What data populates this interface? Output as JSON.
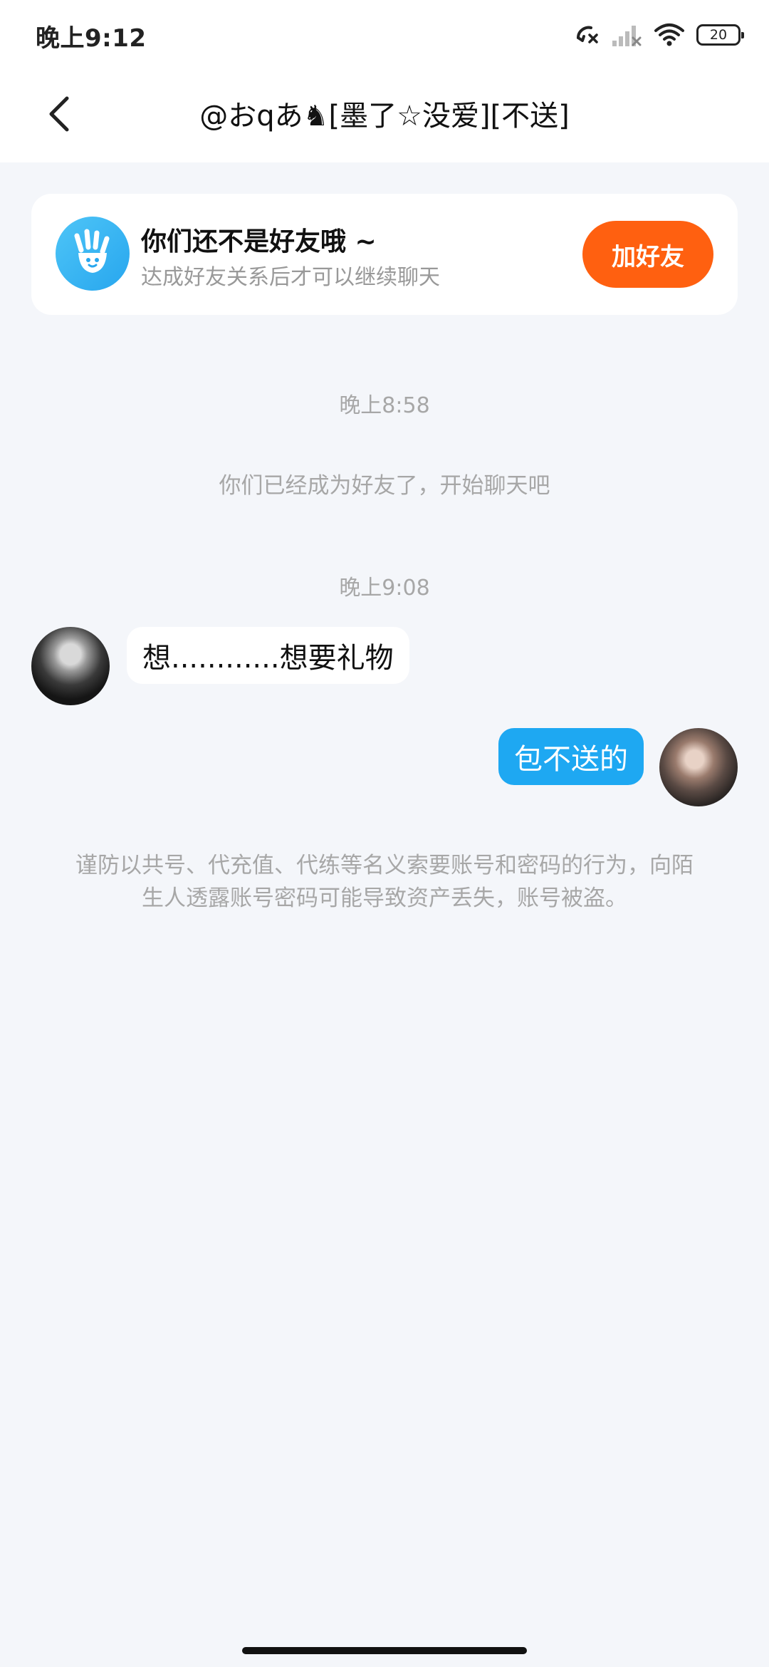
{
  "status_bar": {
    "time": "晚上9:12",
    "battery": "20",
    "icons": [
      "missed-call-icon",
      "signal-off-icon",
      "wifi-icon",
      "battery-icon"
    ]
  },
  "nav": {
    "title": "@おqあ♞[墨了☆没爱][不送]",
    "back_icon": "chevron-left-icon"
  },
  "friend_banner": {
    "title": "你们还不是好友哦 ~",
    "subtitle": "达成好友关系后才可以继续聊天",
    "button_label": "加好友",
    "icon": "waving-hand-icon",
    "accent_color": "#ff6010"
  },
  "chat": {
    "timestamp_1": "晚上8:58",
    "system_message": "你们已经成为好友了，开始聊天吧",
    "timestamp_2": "晚上9:08",
    "incoming_message": "想............想要礼物",
    "outgoing_message": "包不送的",
    "outgoing_bubble_color": "#1ea8f2"
  },
  "safety_notice": {
    "line_1": "谨防以共号、代充值、代练等名义索要账号和密码的行为，向陌",
    "line_2": "生人透露账号密码可能导致资产丢失，账号被盗。"
  }
}
